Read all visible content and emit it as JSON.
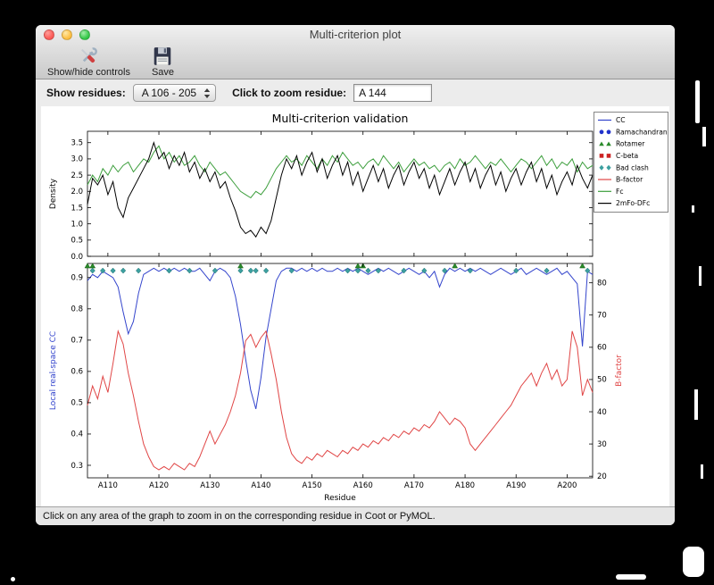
{
  "window": {
    "title": "Multi-criterion plot"
  },
  "toolbar": {
    "buttons": [
      {
        "label": "Show/hide controls",
        "icon": "tools-icon"
      },
      {
        "label": "Save",
        "icon": "save-floppy-icon"
      }
    ]
  },
  "controls": {
    "show_residues_label": "Show residues:",
    "residue_range": "A 106 - 205",
    "zoom_label": "Click to zoom residue:",
    "zoom_value": "A 144"
  },
  "status_bar": "Click on any area of the graph to zoom in on the corresponding residue in Coot or PyMOL.",
  "chart_data": {
    "type": "line",
    "title": "Multi-criterion validation",
    "x_start": 106,
    "x_end": 205,
    "x_label": "Residue",
    "x_ticks": [
      "A110",
      "A120",
      "A130",
      "A140",
      "A150",
      "A160",
      "A170",
      "A180",
      "A190",
      "A200"
    ],
    "top": {
      "ylabel": "Density",
      "ylim": [
        0,
        3.85
      ],
      "yticks": [
        0.0,
        0.5,
        1.0,
        1.5,
        2.0,
        2.5,
        3.0,
        3.5
      ],
      "series": [
        {
          "name": "Fc",
          "color": "#3c9e3c",
          "values": [
            2.2,
            2.5,
            2.3,
            2.7,
            2.5,
            2.8,
            2.6,
            2.8,
            2.9,
            2.6,
            2.8,
            3.0,
            2.9,
            3.2,
            3.4,
            3.0,
            3.2,
            2.9,
            3.1,
            2.8,
            2.9,
            3.1,
            2.8,
            2.6,
            2.9,
            2.7,
            2.5,
            2.6,
            2.4,
            2.2,
            2.0,
            1.9,
            1.8,
            2.0,
            1.9,
            2.1,
            2.4,
            2.7,
            2.9,
            3.1,
            2.9,
            3.0,
            2.8,
            3.1,
            2.9,
            2.7,
            3.0,
            2.8,
            3.1,
            2.9,
            3.2,
            3.0,
            2.8,
            2.9,
            2.7,
            2.9,
            3.0,
            2.8,
            3.1,
            2.9,
            2.7,
            2.9,
            2.6,
            2.8,
            3.0,
            2.8,
            2.9,
            2.7,
            2.8,
            2.6,
            2.8,
            2.9,
            2.7,
            3.0,
            2.8,
            2.9,
            3.1,
            2.9,
            2.7,
            2.9,
            2.8,
            3.0,
            2.8,
            2.6,
            2.8,
            3.0,
            2.9,
            2.7,
            2.9,
            3.1,
            2.8,
            3.0,
            2.7,
            2.9,
            2.8,
            3.0,
            2.6,
            2.9,
            2.7,
            2.8
          ]
        },
        {
          "name": "2mFo-DFc",
          "color": "#000000",
          "values": [
            1.6,
            2.4,
            2.2,
            2.5,
            1.9,
            2.3,
            1.5,
            1.2,
            1.8,
            2.1,
            2.4,
            2.7,
            3.0,
            3.5,
            3.0,
            3.2,
            2.7,
            3.1,
            2.8,
            3.2,
            2.6,
            2.9,
            2.4,
            2.7,
            2.3,
            2.6,
            2.1,
            2.3,
            1.8,
            1.4,
            0.9,
            0.7,
            0.8,
            0.6,
            0.9,
            0.7,
            1.1,
            1.8,
            2.5,
            3.0,
            2.7,
            3.1,
            2.5,
            2.9,
            3.2,
            2.6,
            3.0,
            2.4,
            2.8,
            3.1,
            2.5,
            2.9,
            2.2,
            2.6,
            2.0,
            2.4,
            2.8,
            2.3,
            2.7,
            2.1,
            2.5,
            2.8,
            2.2,
            2.6,
            2.9,
            2.4,
            2.7,
            2.1,
            2.5,
            1.9,
            2.3,
            2.7,
            2.2,
            2.6,
            2.9,
            2.3,
            2.7,
            2.1,
            2.5,
            2.8,
            2.2,
            2.6,
            2.0,
            2.4,
            2.7,
            2.2,
            2.6,
            2.9,
            2.3,
            2.7,
            2.1,
            2.5,
            1.9,
            2.3,
            2.6,
            2.2,
            2.8,
            2.4,
            2.1,
            2.5
          ]
        }
      ]
    },
    "bottom": {
      "ylabel_left": "Local real-space CC",
      "ylabel_left_color": "#3344cc",
      "ylim_left": [
        0.26,
        0.945
      ],
      "yticks_left": [
        0.3,
        0.4,
        0.5,
        0.6,
        0.7,
        0.8,
        0.9
      ],
      "ylabel_right": "B-factor",
      "ylabel_right_color": "#e04545",
      "ylim_right": [
        19.5,
        86
      ],
      "yticks_right": [
        20,
        30,
        40,
        50,
        60,
        70,
        80
      ],
      "series": [
        {
          "name": "CC",
          "axis": "left",
          "color": "#3344cc",
          "values": [
            0.89,
            0.91,
            0.9,
            0.92,
            0.91,
            0.9,
            0.87,
            0.79,
            0.72,
            0.76,
            0.85,
            0.91,
            0.92,
            0.93,
            0.92,
            0.93,
            0.92,
            0.93,
            0.92,
            0.93,
            0.92,
            0.92,
            0.93,
            0.91,
            0.89,
            0.92,
            0.93,
            0.92,
            0.9,
            0.84,
            0.75,
            0.64,
            0.54,
            0.48,
            0.58,
            0.71,
            0.8,
            0.89,
            0.92,
            0.93,
            0.93,
            0.92,
            0.93,
            0.92,
            0.93,
            0.92,
            0.93,
            0.92,
            0.92,
            0.93,
            0.92,
            0.93,
            0.92,
            0.93,
            0.92,
            0.91,
            0.92,
            0.93,
            0.92,
            0.93,
            0.92,
            0.91,
            0.92,
            0.93,
            0.92,
            0.91,
            0.92,
            0.9,
            0.92,
            0.87,
            0.91,
            0.93,
            0.92,
            0.93,
            0.92,
            0.93,
            0.92,
            0.93,
            0.92,
            0.91,
            0.92,
            0.93,
            0.92,
            0.91,
            0.92,
            0.93,
            0.91,
            0.92,
            0.93,
            0.92,
            0.91,
            0.92,
            0.93,
            0.91,
            0.92,
            0.9,
            0.88,
            0.68,
            0.92,
            0.91
          ]
        },
        {
          "name": "B-factor",
          "axis": "right",
          "color": "#e04545",
          "values": [
            42,
            48,
            44,
            51,
            46,
            55,
            65,
            61,
            52,
            45,
            37,
            30,
            26,
            23,
            22,
            23,
            22,
            24,
            23,
            22,
            24,
            23,
            26,
            30,
            34,
            30,
            33,
            36,
            40,
            45,
            52,
            62,
            64,
            60,
            63,
            65,
            58,
            50,
            40,
            32,
            27,
            25,
            24,
            26,
            25,
            27,
            26,
            28,
            27,
            26,
            28,
            27,
            29,
            28,
            30,
            29,
            31,
            30,
            32,
            31,
            33,
            32,
            34,
            33,
            35,
            34,
            36,
            35,
            37,
            40,
            38,
            36,
            38,
            37,
            35,
            30,
            28,
            30,
            32,
            34,
            36,
            38,
            40,
            42,
            45,
            48,
            50,
            52,
            48,
            52,
            55,
            50,
            53,
            48,
            50,
            65,
            60,
            45,
            50,
            46
          ]
        }
      ],
      "markers": [
        {
          "name": "Bad clash",
          "shape": "diamond",
          "color": "#3ca0a0",
          "y": 0.922,
          "residues": [
            107,
            109,
            111,
            113,
            116,
            122,
            126,
            131,
            136,
            138,
            139,
            141,
            146,
            157,
            159,
            161,
            163,
            168,
            172,
            176,
            181,
            190,
            196,
            204
          ]
        },
        {
          "name": "Rotamer",
          "shape": "triangle",
          "color": "#2a8a2a",
          "y": 0.9375,
          "residues": [
            106,
            107,
            136,
            159,
            160,
            178,
            203
          ]
        }
      ]
    },
    "legend": [
      {
        "label": "CC",
        "marker": "line",
        "color": "#3344cc"
      },
      {
        "label": "Ramachandran",
        "marker": "circles",
        "color": "#2233cc"
      },
      {
        "label": "Rotamer",
        "marker": "triangles",
        "color": "#2a8a2a"
      },
      {
        "label": "C-beta",
        "marker": "squares",
        "color": "#cc2222"
      },
      {
        "label": "Bad clash",
        "marker": "diamonds",
        "color": "#3ca0a0"
      },
      {
        "label": "B-factor",
        "marker": "line",
        "color": "#e04545"
      },
      {
        "label": "Fc",
        "marker": "line",
        "color": "#3c9e3c"
      },
      {
        "label": "2mFo-DFc",
        "marker": "line",
        "color": "#000000"
      }
    ]
  }
}
